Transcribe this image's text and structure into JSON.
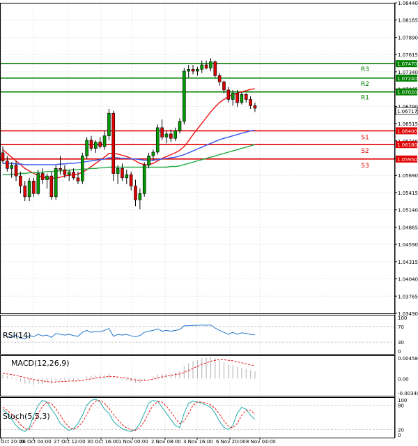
{
  "chart_data": {
    "type": "candlestick",
    "symbol_pair": "EURUSD",
    "price_axis": {
      "ticks": [
        "1.08440",
        "1.08165",
        "1.07890",
        "1.07615",
        "1.07340",
        "1.07065",
        "1.06790",
        "1.06515",
        "1.06240",
        "1.05965",
        "1.05690",
        "1.05415",
        "1.05140",
        "1.04865",
        "1.04590",
        "1.04315",
        "1.04040",
        "1.03765",
        "1.03490"
      ],
      "range": [
        1.0349,
        1.0844
      ],
      "current_price": "1.06717"
    },
    "time_axis": {
      "labels": [
        "Oct 20:00",
        "26 Oct 04:00",
        "27 Oct 12:00",
        "30 Oct 16:00",
        "1 Nov 00:00",
        "2 Nov 08:00",
        "3 Nov 16:00",
        "6 Nov 20:00",
        "8 Nov 04:00"
      ]
    },
    "levels": [
      {
        "label": "R3",
        "value": 1.0747,
        "price_label": "1.07470",
        "color": "#008000"
      },
      {
        "label": "R2",
        "value": 1.0724,
        "price_label": "1.07240",
        "color": "#008000"
      },
      {
        "label": "R1",
        "value": 1.0702,
        "price_label": "1.07020",
        "color": "#008000"
      },
      {
        "label": "S1",
        "value": 1.064,
        "price_label": "1.06400",
        "color": "#e00000"
      },
      {
        "label": "S2",
        "value": 1.0618,
        "price_label": "1.06180",
        "color": "#e00000"
      },
      {
        "label": "S3",
        "value": 1.0595,
        "price_label": "1.05950",
        "color": "#e00000"
      }
    ],
    "candles": [
      {
        "o": 1.0605,
        "h": 1.0615,
        "l": 1.0588,
        "c": 1.0592
      },
      {
        "o": 1.0592,
        "h": 1.06,
        "l": 1.0575,
        "c": 1.058
      },
      {
        "o": 1.058,
        "h": 1.059,
        "l": 1.0565,
        "c": 1.0585
      },
      {
        "o": 1.0585,
        "h": 1.0592,
        "l": 1.056,
        "c": 1.0568
      },
      {
        "o": 1.0568,
        "h": 1.0575,
        "l": 1.054,
        "c": 1.0552
      },
      {
        "o": 1.0552,
        "h": 1.056,
        "l": 1.0528,
        "c": 1.0535
      },
      {
        "o": 1.0535,
        "h": 1.0565,
        "l": 1.0528,
        "c": 1.056
      },
      {
        "o": 1.056,
        "h": 1.0565,
        "l": 1.0535,
        "c": 1.054
      },
      {
        "o": 1.054,
        "h": 1.0578,
        "l": 1.0538,
        "c": 1.0572
      },
      {
        "o": 1.0572,
        "h": 1.058,
        "l": 1.0555,
        "c": 1.0562
      },
      {
        "o": 1.0562,
        "h": 1.0572,
        "l": 1.0548,
        "c": 1.0568
      },
      {
        "o": 1.0568,
        "h": 1.0575,
        "l": 1.053,
        "c": 1.0535
      },
      {
        "o": 1.0535,
        "h": 1.0585,
        "l": 1.053,
        "c": 1.058
      },
      {
        "o": 1.058,
        "h": 1.06,
        "l": 1.057,
        "c": 1.0578
      },
      {
        "o": 1.0578,
        "h": 1.0585,
        "l": 1.0565,
        "c": 1.057
      },
      {
        "o": 1.057,
        "h": 1.0578,
        "l": 1.056,
        "c": 1.0574
      },
      {
        "o": 1.0574,
        "h": 1.058,
        "l": 1.0562,
        "c": 1.0565
      },
      {
        "o": 1.0565,
        "h": 1.0575,
        "l": 1.0555,
        "c": 1.056
      },
      {
        "o": 1.056,
        "h": 1.0605,
        "l": 1.0555,
        "c": 1.06
      },
      {
        "o": 1.06,
        "h": 1.063,
        "l": 1.0595,
        "c": 1.0625
      },
      {
        "o": 1.0625,
        "h": 1.0632,
        "l": 1.0608,
        "c": 1.0612
      },
      {
        "o": 1.0612,
        "h": 1.0625,
        "l": 1.0605,
        "c": 1.0622
      },
      {
        "o": 1.0622,
        "h": 1.063,
        "l": 1.0612,
        "c": 1.0615
      },
      {
        "o": 1.0615,
        "h": 1.064,
        "l": 1.061,
        "c": 1.0632
      },
      {
        "o": 1.0632,
        "h": 1.0675,
        "l": 1.0625,
        "c": 1.0668
      },
      {
        "o": 1.0668,
        "h": 1.0672,
        "l": 1.056,
        "c": 1.0572
      },
      {
        "o": 1.0572,
        "h": 1.0585,
        "l": 1.0555,
        "c": 1.058
      },
      {
        "o": 1.058,
        "h": 1.0588,
        "l": 1.056,
        "c": 1.0565
      },
      {
        "o": 1.0565,
        "h": 1.0578,
        "l": 1.0555,
        "c": 1.057
      },
      {
        "o": 1.057,
        "h": 1.0575,
        "l": 1.0545,
        "c": 1.0552
      },
      {
        "o": 1.0552,
        "h": 1.0562,
        "l": 1.052,
        "c": 1.053
      },
      {
        "o": 1.053,
        "h": 1.0548,
        "l": 1.0515,
        "c": 1.054
      },
      {
        "o": 1.054,
        "h": 1.059,
        "l": 1.0535,
        "c": 1.0585
      },
      {
        "o": 1.0585,
        "h": 1.0605,
        "l": 1.058,
        "c": 1.06
      },
      {
        "o": 1.06,
        "h": 1.061,
        "l": 1.0592,
        "c": 1.0606
      },
      {
        "o": 1.0606,
        "h": 1.065,
        "l": 1.0602,
        "c": 1.0645
      },
      {
        "o": 1.0645,
        "h": 1.0658,
        "l": 1.0625,
        "c": 1.063
      },
      {
        "o": 1.063,
        "h": 1.064,
        "l": 1.062,
        "c": 1.0635
      },
      {
        "o": 1.0635,
        "h": 1.0642,
        "l": 1.0622,
        "c": 1.0628
      },
      {
        "o": 1.0628,
        "h": 1.0645,
        "l": 1.0624,
        "c": 1.064
      },
      {
        "o": 1.064,
        "h": 1.066,
        "l": 1.0636,
        "c": 1.0655
      },
      {
        "o": 1.0655,
        "h": 1.074,
        "l": 1.065,
        "c": 1.0735
      },
      {
        "o": 1.0735,
        "h": 1.0745,
        "l": 1.0725,
        "c": 1.0738
      },
      {
        "o": 1.0738,
        "h": 1.0745,
        "l": 1.073,
        "c": 1.0735
      },
      {
        "o": 1.0735,
        "h": 1.0742,
        "l": 1.0728,
        "c": 1.0738
      },
      {
        "o": 1.0738,
        "h": 1.0752,
        "l": 1.0732,
        "c": 1.0745
      },
      {
        "o": 1.0745,
        "h": 1.0752,
        "l": 1.0738,
        "c": 1.074
      },
      {
        "o": 1.074,
        "h": 1.0756,
        "l": 1.0735,
        "c": 1.075
      },
      {
        "o": 1.075,
        "h": 1.0752,
        "l": 1.0725,
        "c": 1.0728
      },
      {
        "o": 1.0728,
        "h": 1.0732,
        "l": 1.0712,
        "c": 1.0718
      },
      {
        "o": 1.0718,
        "h": 1.072,
        "l": 1.07,
        "c": 1.0705
      },
      {
        "o": 1.0705,
        "h": 1.071,
        "l": 1.0685,
        "c": 1.069
      },
      {
        "o": 1.069,
        "h": 1.0705,
        "l": 1.068,
        "c": 1.07
      },
      {
        "o": 1.07,
        "h": 1.0705,
        "l": 1.0678,
        "c": 1.0685
      },
      {
        "o": 1.0685,
        "h": 1.0702,
        "l": 1.0682,
        "c": 1.0698
      },
      {
        "o": 1.0698,
        "h": 1.07,
        "l": 1.0685,
        "c": 1.069
      },
      {
        "o": 1.069,
        "h": 1.0695,
        "l": 1.0675,
        "c": 1.068
      },
      {
        "o": 1.068,
        "h": 1.0685,
        "l": 1.067,
        "c": 1.0676
      }
    ],
    "moving_averages": [
      {
        "name": "MA fast",
        "color": "#ee1111",
        "values": [
          1.061,
          1.0604,
          1.0598,
          1.0592,
          1.0586,
          1.058,
          1.0576,
          1.0572,
          1.0569,
          1.0566,
          1.0565,
          1.0564,
          1.0565,
          1.0566,
          1.0568,
          1.0569,
          1.057,
          1.0571,
          1.0574,
          1.0578,
          1.0583,
          1.0588,
          1.0593,
          1.0598,
          1.0604,
          1.0604,
          1.0603,
          1.0601,
          1.0599,
          1.0596,
          1.0592,
          1.0588,
          1.0586,
          1.0586,
          1.0588,
          1.0592,
          1.0596,
          1.0599,
          1.0602,
          1.0605,
          1.0609,
          1.0615,
          1.0624,
          1.0634,
          1.0643,
          1.0652,
          1.0661,
          1.067,
          1.0678,
          1.0685,
          1.069,
          1.0694,
          1.0698,
          1.07,
          1.0702,
          1.0704,
          1.0706,
          1.0707
        ]
      },
      {
        "name": "MA medium",
        "color": "#3355ee",
        "values": [
          1.0588,
          1.0588,
          1.0588,
          1.0587,
          1.0587,
          1.0586,
          1.0586,
          1.0586,
          1.0586,
          1.0586,
          1.0586,
          1.0586,
          1.0586,
          1.0587,
          1.0587,
          1.0588,
          1.0588,
          1.0589,
          1.059,
          1.0591,
          1.0592,
          1.0593,
          1.0594,
          1.0595,
          1.0597,
          1.0597,
          1.0597,
          1.0596,
          1.0596,
          1.0595,
          1.0595,
          1.0594,
          1.0593,
          1.0593,
          1.0593,
          1.0594,
          1.0595,
          1.0596,
          1.0597,
          1.0598,
          1.06,
          1.0602,
          1.0605,
          1.0608,
          1.0611,
          1.0614,
          1.0617,
          1.062,
          1.0623,
          1.0626,
          1.0628,
          1.063,
          1.0632,
          1.0634,
          1.0636,
          1.0638,
          1.064,
          1.0641
        ]
      },
      {
        "name": "MA slow",
        "color": "#22aa44",
        "values": [
          1.057,
          1.057,
          1.0571,
          1.0571,
          1.0572,
          1.0572,
          1.0573,
          1.0573,
          1.0574,
          1.0574,
          1.0575,
          1.0575,
          1.0576,
          1.0576,
          1.0577,
          1.0577,
          1.0578,
          1.0578,
          1.0579,
          1.0579,
          1.058,
          1.058,
          1.0581,
          1.0581,
          1.0582,
          1.0582,
          1.0582,
          1.0582,
          1.0582,
          1.0582,
          1.0582,
          1.0582,
          1.0582,
          1.0582,
          1.0582,
          1.0582,
          1.0582,
          1.0582,
          1.0583,
          1.0583,
          1.0584,
          1.0586,
          1.0588,
          1.059,
          1.0592,
          1.0594,
          1.0596,
          1.0598,
          1.06,
          1.0602,
          1.0604,
          1.0606,
          1.0608,
          1.061,
          1.0612,
          1.0614,
          1.0616,
          1.0618
        ]
      }
    ],
    "indicators": [
      {
        "name": "RSI(14)",
        "ticks": [
          "100",
          "70",
          "30",
          "0"
        ],
        "range": [
          0,
          100
        ],
        "color": "#2277cc",
        "values": [
          50,
          45,
          42,
          48,
          40,
          38,
          47,
          44,
          50,
          46,
          48,
          42,
          52,
          50,
          48,
          50,
          47,
          45,
          55,
          60,
          55,
          58,
          56,
          60,
          65,
          45,
          50,
          48,
          50,
          46,
          44,
          47,
          55,
          58,
          60,
          64,
          58,
          60,
          58,
          60,
          62,
          72,
          72,
          73,
          73,
          74,
          73,
          74,
          66,
          60,
          55,
          50,
          55,
          50,
          54,
          52,
          50,
          49
        ]
      },
      {
        "name": "MACD(12,26,9)",
        "ticks": [
          "0.004585",
          "0.00",
          "-0.003404"
        ],
        "range": [
          -0.003404,
          0.004585
        ],
        "signal_color": "#ee1111",
        "histogram_color": "#bbbbbb",
        "histogram": [
          0.0008,
          0.0005,
          0.0002,
          -0.0002,
          -0.0006,
          -0.001,
          -0.001,
          -0.0012,
          -0.001,
          -0.001,
          -0.0008,
          -0.001,
          -0.0006,
          -0.0004,
          -0.0004,
          -0.0003,
          -0.0004,
          -0.0004,
          0.0,
          0.0004,
          0.0005,
          0.0006,
          0.0006,
          0.0007,
          0.001,
          0.0002,
          0.0,
          -0.0002,
          -0.0004,
          -0.0006,
          -0.0009,
          -0.0009,
          -0.0004,
          0.0,
          0.0004,
          0.0008,
          0.0009,
          0.0009,
          0.001,
          0.0012,
          0.0014,
          0.0024,
          0.003,
          0.0034,
          0.0036,
          0.004,
          0.0041,
          0.0042,
          0.004,
          0.0036,
          0.0032,
          0.0028,
          0.0026,
          0.0023,
          0.0021,
          0.0019,
          0.0016,
          0.0014
        ],
        "signal": [
          0.001,
          0.0009,
          0.0008,
          0.0006,
          0.0004,
          0.0002,
          0.0,
          -0.0002,
          -0.0004,
          -0.0005,
          -0.0006,
          -0.0007,
          -0.0007,
          -0.0006,
          -0.0006,
          -0.0005,
          -0.0005,
          -0.0005,
          -0.0004,
          -0.0002,
          -0.0001,
          0.0001,
          0.0002,
          0.0003,
          0.0004,
          0.0004,
          0.0003,
          0.0002,
          0.0001,
          -0.0001,
          -0.0003,
          -0.0004,
          -0.0004,
          -0.0003,
          -0.0001,
          0.0001,
          0.0003,
          0.0005,
          0.0006,
          0.0008,
          0.0009,
          0.0012,
          0.0016,
          0.002,
          0.0024,
          0.0028,
          0.0031,
          0.0034,
          0.0036,
          0.0037,
          0.0037,
          0.0036,
          0.0035,
          0.0033,
          0.0031,
          0.0029,
          0.0027,
          0.0025
        ]
      },
      {
        "name": "Stoch(5,5,3)",
        "ticks": [
          "100",
          "80",
          "20",
          "0"
        ],
        "range": [
          0,
          100
        ],
        "main_color": "#22aaaa",
        "signal_color": "#ee1111",
        "main": [
          70,
          60,
          45,
          30,
          20,
          15,
          25,
          55,
          80,
          92,
          88,
          70,
          55,
          35,
          25,
          18,
          22,
          35,
          55,
          80,
          92,
          95,
          88,
          70,
          60,
          40,
          30,
          22,
          18,
          15,
          20,
          35,
          60,
          85,
          92,
          90,
          75,
          60,
          45,
          30,
          25,
          60,
          85,
          90,
          88,
          85,
          80,
          75,
          60,
          40,
          25,
          20,
          30,
          60,
          75,
          70,
          55,
          45
        ],
        "signal": [
          75,
          68,
          58,
          45,
          32,
          22,
          20,
          35,
          58,
          78,
          88,
          84,
          72,
          55,
          38,
          26,
          21,
          26,
          38,
          57,
          78,
          90,
          92,
          85,
          72,
          58,
          44,
          32,
          24,
          19,
          18,
          25,
          40,
          62,
          80,
          89,
          88,
          78,
          64,
          48,
          35,
          40,
          60,
          80,
          88,
          88,
          85,
          81,
          72,
          58,
          42,
          28,
          24,
          35,
          55,
          68,
          68,
          58
        ]
      }
    ]
  }
}
